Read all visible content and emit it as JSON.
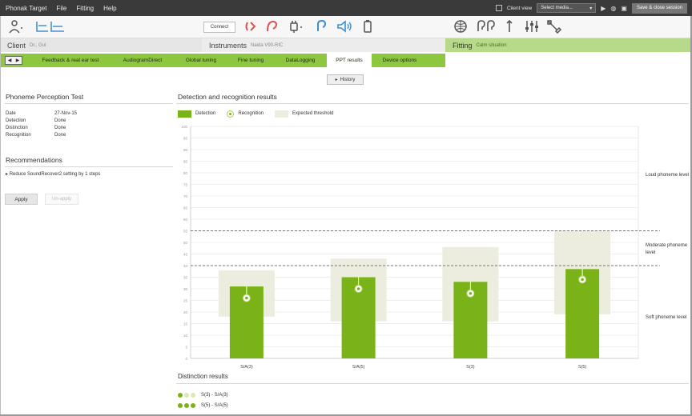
{
  "menubar": {
    "app_title": "Phonak Target",
    "menus": [
      "File",
      "Fitting",
      "Help"
    ],
    "client_view_label": "Client view",
    "media_select": "Select media...",
    "save_close_label": "Save & close session"
  },
  "toolbar": {
    "connect_label": "Connect",
    "icons": [
      "person-icon",
      "audiogram-icon",
      "hearing-aid-left-icon",
      "hearing-aid-right-icon",
      "plug-icon",
      "ear-left-icon",
      "speaker-icon",
      "battery-icon",
      "globe-icon",
      "ears-icon",
      "pin-icon",
      "sliders-icon",
      "wrench-icon"
    ]
  },
  "sections": {
    "client": {
      "label": "Client",
      "sub": "Dr., Gui"
    },
    "instruments": {
      "label": "Instruments",
      "sub": "Naida V90-RIC"
    },
    "fitting": {
      "label": "Fitting",
      "sub": "Calm situation"
    }
  },
  "tabs": [
    {
      "label": "Feedback & real ear test"
    },
    {
      "label": "AudiogramDirect"
    },
    {
      "label": "Global tuning"
    },
    {
      "label": "Fine tuning"
    },
    {
      "label": "DataLogging"
    },
    {
      "label": "PPT results",
      "active": true
    },
    {
      "label": "Device options"
    }
  ],
  "history_label": "History",
  "ppt": {
    "title": "Phoneme Perception Test",
    "rows": [
      {
        "label": "Date",
        "value": "27-Nov-15"
      },
      {
        "label": "Detection",
        "value": "Done"
      },
      {
        "label": "Distinction",
        "value": "Done"
      },
      {
        "label": "Recognition",
        "value": "Done"
      }
    ]
  },
  "recommendations": {
    "title": "Recommendations",
    "items": [
      "Reduce SoundRecover2 setting by 1 steps"
    ],
    "apply_label": "Apply",
    "unapply_label": "Un-apply"
  },
  "results": {
    "title": "Detection and recognition results",
    "legend": {
      "detection": "Detection",
      "recognition": "Recognition",
      "expected": "Expected threshold"
    },
    "levels": {
      "loud": "Loud phoneme level",
      "moderate": "Moderate phoneme level",
      "soft": "Soft phoneme level"
    }
  },
  "colors": {
    "detection_bar": "#7ab317",
    "expected_band": "#ececdf",
    "tab_green": "#8dc63f",
    "fitting_green": "#b7d98a"
  },
  "chart_data": {
    "type": "bar",
    "categories": [
      "S/A(3)",
      "S/A(5)",
      "S(3)",
      "S(5)"
    ],
    "series": [
      {
        "name": "Detection",
        "values": [
          31,
          35,
          33,
          38.5
        ]
      },
      {
        "name": "Recognition",
        "values": [
          26,
          30,
          28,
          34
        ]
      },
      {
        "name": "Expected threshold",
        "ranges": [
          [
            18,
            38
          ],
          [
            16,
            43
          ],
          [
            16,
            48
          ],
          [
            19,
            55
          ]
        ]
      }
    ],
    "yticks": [
      0,
      5,
      10,
      15,
      20,
      25,
      30,
      35,
      40,
      45,
      50,
      55,
      60,
      65,
      70,
      75,
      80,
      85,
      90,
      95,
      100
    ],
    "ylim": [
      0,
      100
    ],
    "reference_lines": [
      40,
      55
    ],
    "grid": true,
    "legend": "top-left"
  },
  "distinction": {
    "title": "Distinction results",
    "rows": [
      {
        "dots": [
          true,
          false,
          false
        ],
        "text": "S(3)  -  S/A(3)"
      },
      {
        "dots": [
          true,
          true,
          true
        ],
        "text": "S(5)  -  S/A(5)"
      }
    ]
  }
}
